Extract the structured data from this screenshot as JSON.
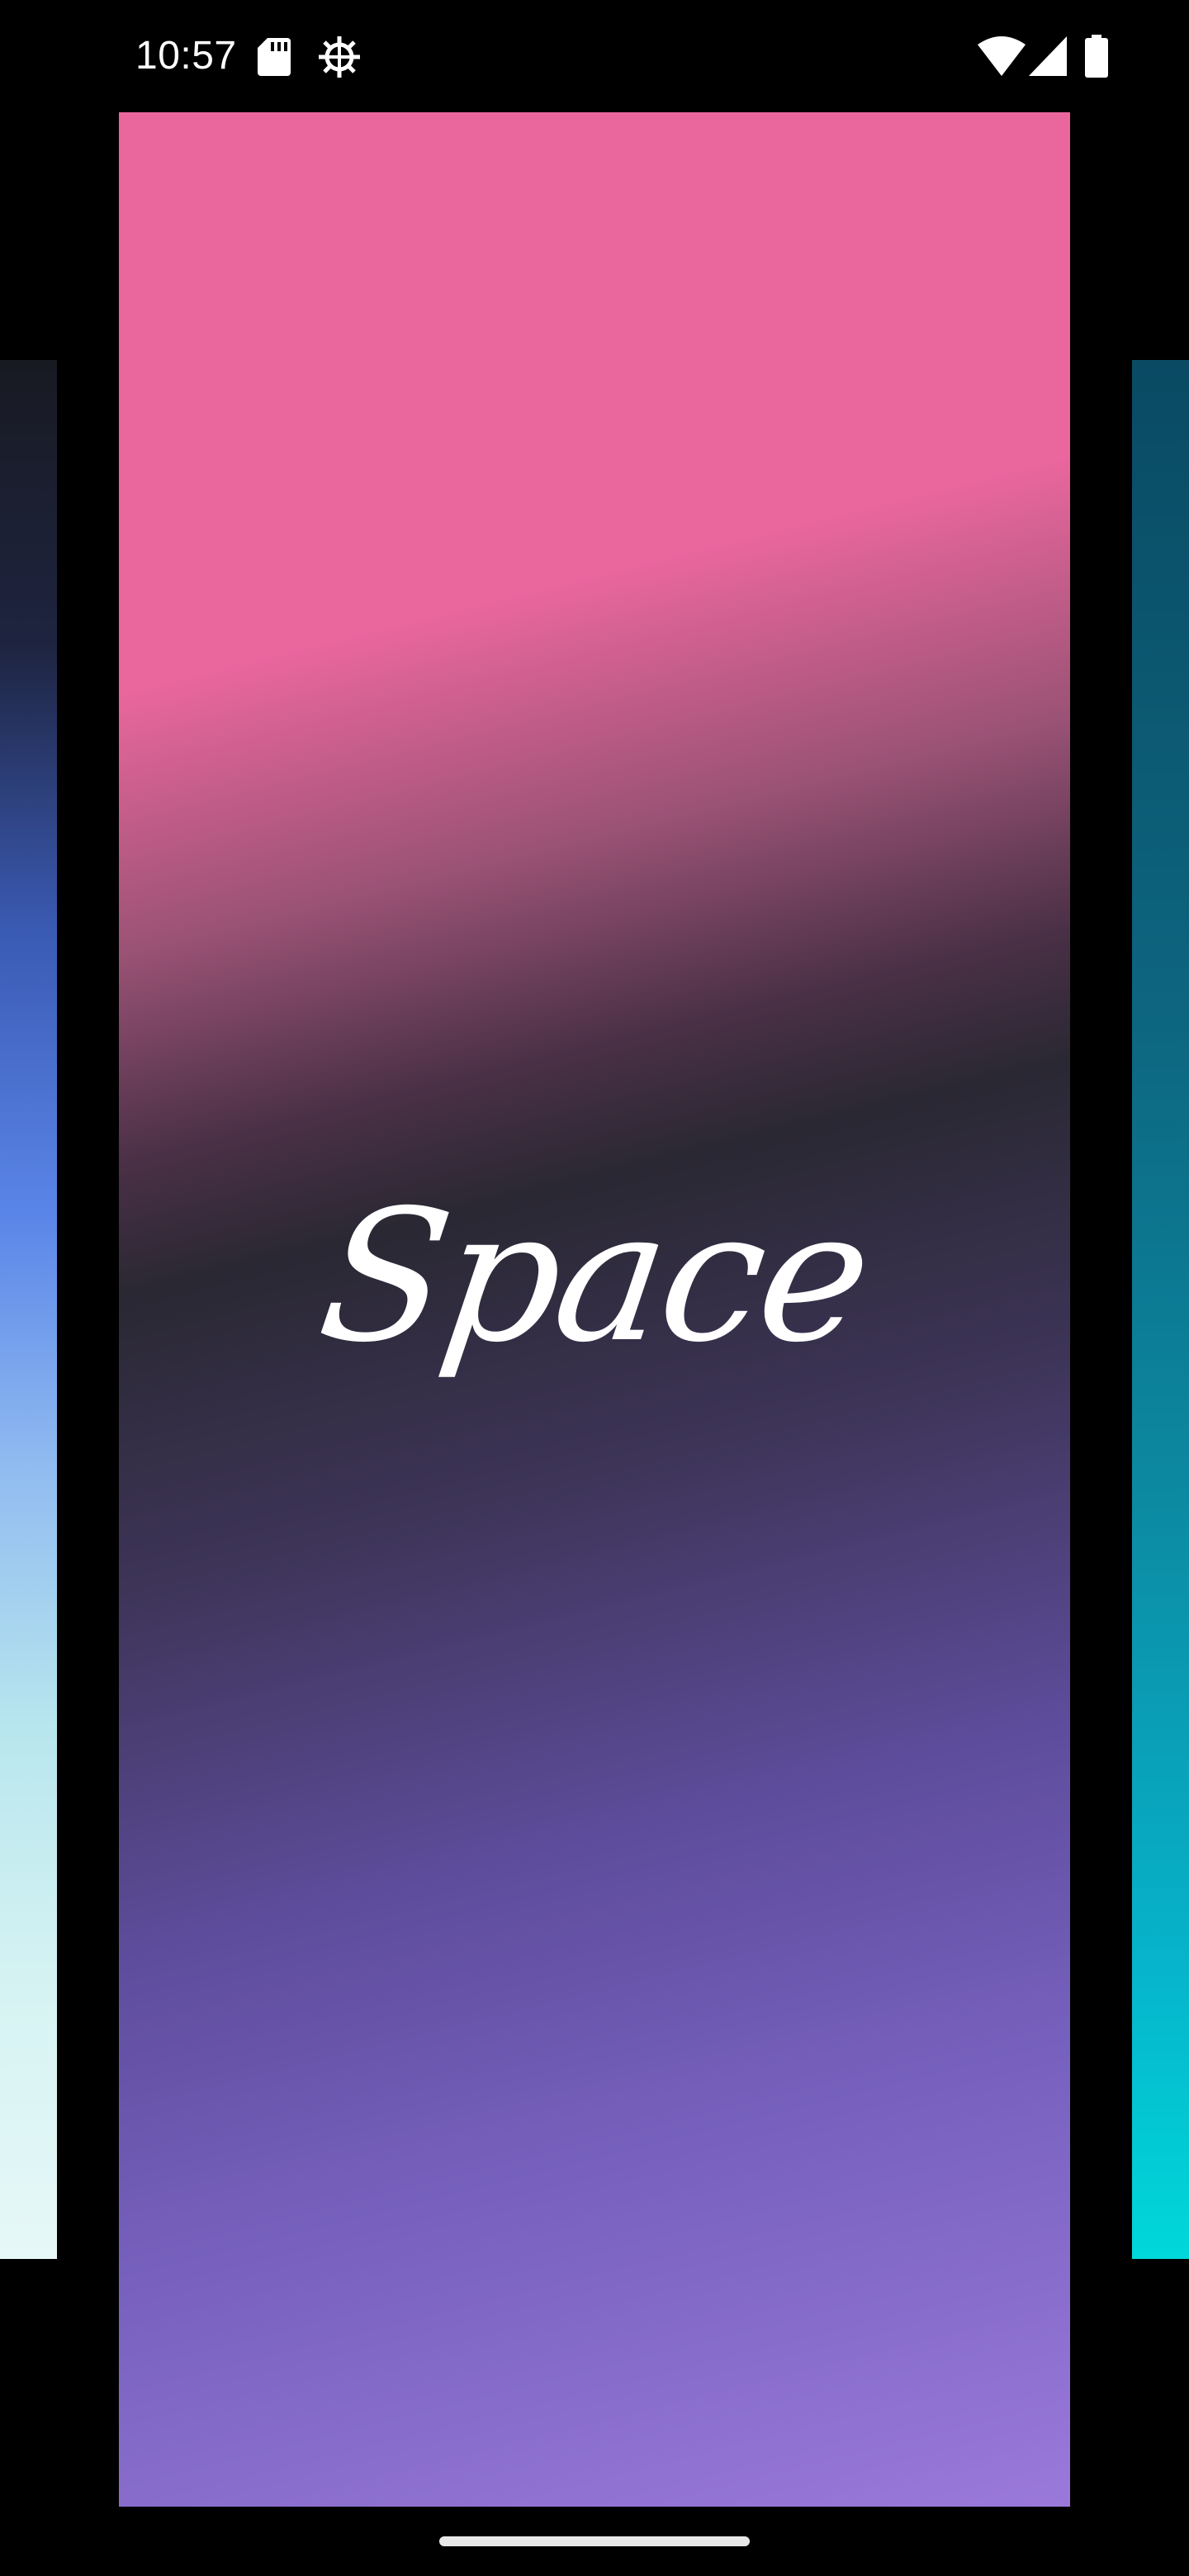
{
  "status_bar": {
    "time": "10:57",
    "icons": [
      "sd-card-icon",
      "gear-icon",
      "wifi-icon",
      "cell-signal-icon",
      "battery-icon"
    ]
  },
  "carousel": {
    "current_card": {
      "title": "Space",
      "colors": {
        "top": "#ea679e",
        "middle": "#2a2833",
        "bottom": "#9a79da"
      }
    },
    "left_card": {
      "colors": {
        "top": "#181a22",
        "middle": "#5a85e8",
        "bottom": "#e6f8f7"
      }
    },
    "right_card": {
      "colors": {
        "top": "#0a4a63",
        "bottom": "#00d8da"
      }
    }
  },
  "navigation": {
    "home_indicator": "gesture-bar"
  }
}
